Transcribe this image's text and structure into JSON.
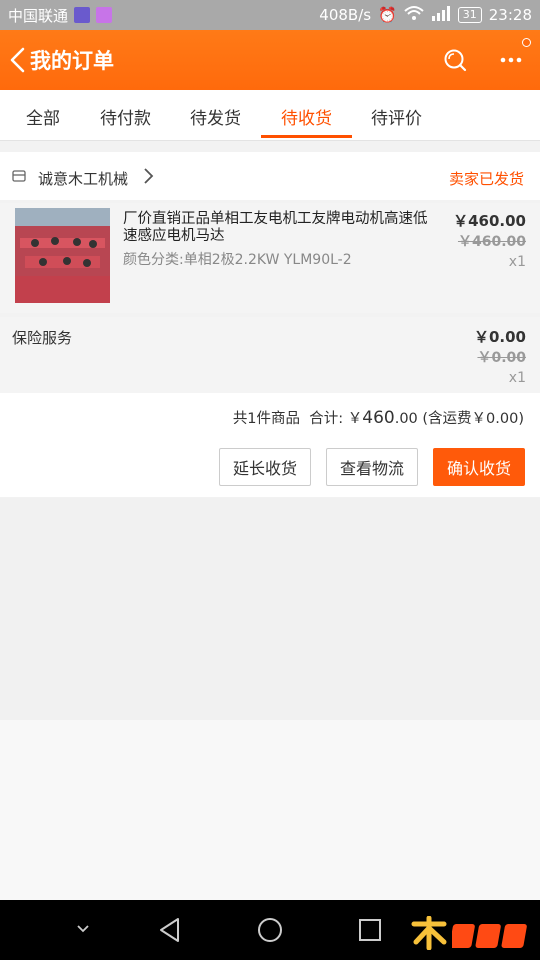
{
  "status_bar": {
    "carrier": "中国联通",
    "speed": "408B/s",
    "network": "4G",
    "battery": "31",
    "time": "23:28"
  },
  "header": {
    "title": "我的订单"
  },
  "tabs": [
    {
      "label": "全部"
    },
    {
      "label": "待付款"
    },
    {
      "label": "待发货"
    },
    {
      "label": "待收货",
      "active": true
    },
    {
      "label": "待评价"
    }
  ],
  "shop": {
    "name": "诚意木工机械",
    "status": "卖家已发货"
  },
  "item": {
    "name": "厂价直销正品单相工友电机工友牌电动机高速低速感应电机马达",
    "sku": "颜色分类:单相2极2.2KW  YLM90L-2",
    "price": "￥460.00",
    "original_price": "￥460.00",
    "quantity": "x1"
  },
  "insurance": {
    "label": "保险服务",
    "price": "￥0.00",
    "original_price": "￥0.00",
    "quantity": "x1"
  },
  "summary": {
    "count_text": "共1件商品",
    "total_label": "合计:",
    "total_currency": "￥",
    "total_int": "460",
    "total_dec": ".00",
    "shipping": "(含运费￥0.00)"
  },
  "actions": {
    "extend": "延长收货",
    "logistics": "查看物流",
    "confirm": "确认收货"
  },
  "colors": {
    "accent": "#ff5000",
    "header": "#ff6a0c"
  }
}
